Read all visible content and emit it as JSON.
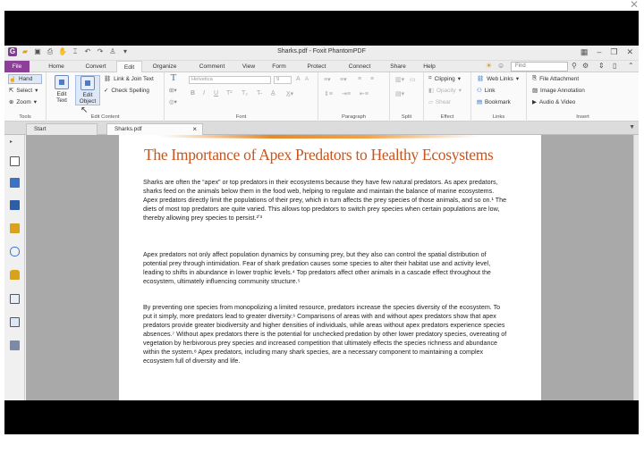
{
  "window": {
    "title": "Sharks.pdf - Foxit PhantomPDF"
  },
  "menu_tabs": [
    {
      "label": "File"
    },
    {
      "label": "Home"
    },
    {
      "label": "Convert"
    },
    {
      "label": "Edit"
    },
    {
      "label": "Organize"
    },
    {
      "label": "Comment"
    },
    {
      "label": "View"
    },
    {
      "label": "Form"
    },
    {
      "label": "Protect"
    },
    {
      "label": "Connect"
    },
    {
      "label": "Share"
    },
    {
      "label": "Help"
    }
  ],
  "search": {
    "placeholder": "Find"
  },
  "ribbon": {
    "tools": {
      "hand": "Hand",
      "select": "Select",
      "zoom": "Zoom",
      "label": "Tools"
    },
    "edit_content": {
      "edit_text": "Edit\nText",
      "edit_object": "Edit\nObject",
      "link_join": "Link & Join Text",
      "check_spelling": "Check Spelling",
      "label": "Edit Content"
    },
    "font": {
      "font_name": "Helvetica",
      "font_size": "9",
      "label": "Font"
    },
    "paragraph": {
      "label": "Paragraph"
    },
    "split": {
      "label": "Split"
    },
    "effect": {
      "clipping": "Clipping",
      "opacity": "Opacity",
      "shear": "Shear",
      "label": "Effect"
    },
    "links": {
      "web_links": "Web Links",
      "link": "Link",
      "bookmark": "Bookmark",
      "label": "Links"
    },
    "insert": {
      "file_attachment": "File Attachment",
      "image_annotation": "Image Annotation",
      "audio_video": "Audio & Video",
      "label": "Insert"
    }
  },
  "doc_tabs": [
    {
      "label": "Start"
    },
    {
      "label": "Sharks.pdf"
    }
  ],
  "document": {
    "title": "The Importance of Apex Predators to Healthy Ecosystems",
    "paragraphs": [
      "Sharks are often the “apex” or top predators in their ecosystems because they have few natural predators. As apex predators, sharks feed on the animals below them in the food web, helping to regulate and maintain the balance of marine ecosystems. Apex predators directly limit the populations of their prey, which in turn affects the prey species of those animals, and so on.¹ The diets of most top predators are quite varied. This allows top predators to switch prey species when certain populations are low, thereby allowing prey species to persist.²ʼ³",
      "Apex predators not only affect population dynamics by consuming prey, but they also can control the spatial distribution of potential prey through intimidation. Fear of shark predation causes some species to alter their habitat use and activity level, leading to shifts in abundance in lower trophic levels.⁴ Top predators affect other animals in a cascade effect throughout the ecosystem, ultimately influencing community structure.⁵",
      "By preventing one species from monopolizing a limited resource, predators increase the species diversity of the ecosystem. To put it simply, more predators lead to greater diversity.⁶ Comparisons of areas with and without apex predators show that apex predators provide greater biodiversity and higher densities of individuals, while areas without apex predators experience species absences.⁷ Without apex predators there is the potential for unchecked predation by other lower predatory species, overeating of vegetation by herbivorous prey species and increased competition that ultimately effects the species richness and abundance within the system.⁸ Apex predators, including many shark species, are a necessary component to maintaining a complex ecosystem full of diversity and life."
    ]
  },
  "colors": {
    "file_tab": "#8e3f99",
    "title_orange": "#c8551f",
    "viewer_bg": "#a9a9a9"
  }
}
